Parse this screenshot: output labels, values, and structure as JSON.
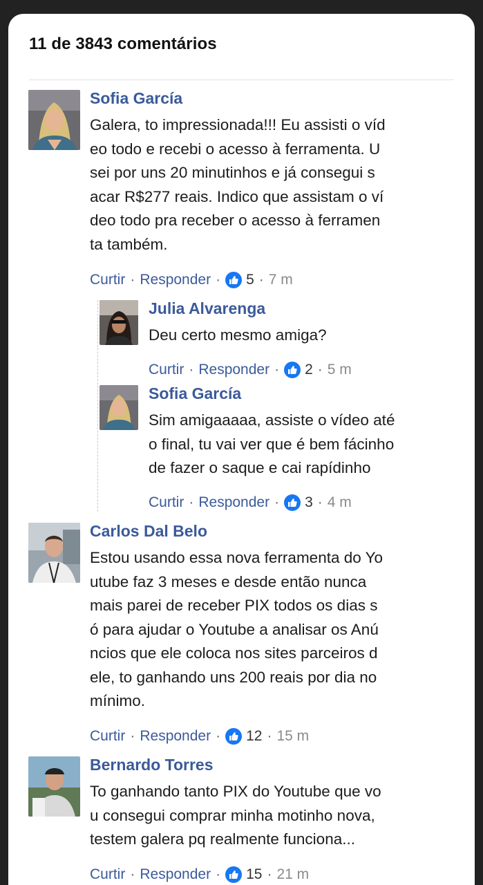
{
  "header": {
    "title": "11 de 3843 comentários"
  },
  "action_labels": {
    "like": "Curtir",
    "reply": "Responder",
    "sep": "·"
  },
  "comments": [
    {
      "name": "Sofia García",
      "text": "Galera, to impressionada!!! Eu assisti o víd\neo todo e recebi o acesso à ferramenta. U\nsei por uns 20 minutinhos e já consegui s\nacar R$277 reais. Indico que assistam o ví\ndeo todo pra receber o acesso à ferramen\nta também.",
      "likes": "5",
      "time": "7 m",
      "replies": [
        {
          "name": "Julia Alvarenga",
          "text": "Deu certo mesmo amiga?",
          "likes": "2",
          "time": "5 m"
        },
        {
          "name": "Sofia García",
          "text": "Sim amigaaaaa, assiste o vídeo até\no final, tu vai ver que é bem fácinho\nde fazer o saque e cai rapídinho",
          "likes": "3",
          "time": "4 m"
        }
      ]
    },
    {
      "name": "Carlos Dal Belo",
      "text": "Estou usando essa nova ferramenta do Yo\nutube faz 3 meses e desde então nunca\nmais parei de receber PIX todos os dias s\nó para ajudar o Youtube a analisar os Anú\nncios que ele coloca nos sites parceiros d\nele, to ganhando uns 200 reais por dia no\nmínimo.",
      "likes": "12",
      "time": "15 m",
      "replies": []
    },
    {
      "name": "Bernardo Torres",
      "text": "To ganhando tanto PIX do Youtube que vo\nu consegui comprar minha motinho nova,\ntestem galera pq realmente funciona...",
      "likes": "15",
      "time": "21 m",
      "replies": []
    }
  ],
  "colors": {
    "name_blue": "#3b5a9a",
    "like_blue": "#1877f2",
    "background": "#222222"
  },
  "icons": {
    "like": "thumbs-up-icon"
  }
}
